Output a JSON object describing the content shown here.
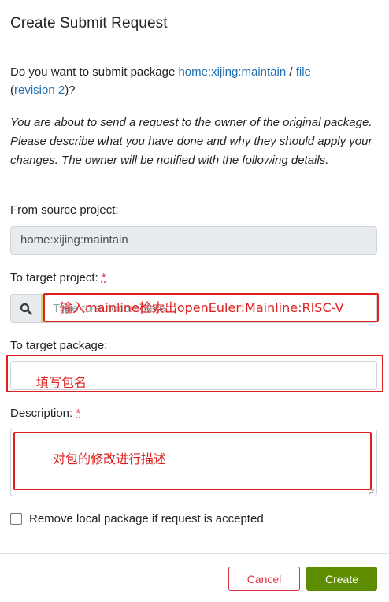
{
  "dialog": {
    "title": "Create Submit Request"
  },
  "intro": {
    "prefix": "Do you want to submit package ",
    "project_link": "home:xijing:maintain",
    "separator": " / ",
    "package_link": "file",
    "open_paren": "(",
    "revision_link": "revision 2",
    "suffix": ")?"
  },
  "note": "You are about to send a request to the owner of the original package. Please describe what you have done and why they should apply your changes. The owner will be notified with the following details.",
  "source_project": {
    "label": "From source project:",
    "value": "home:xijing:maintain"
  },
  "target_project": {
    "label": "To target project:",
    "required_mark": "*",
    "placeholder": "Type to autocomplete..."
  },
  "target_package": {
    "label": "To target package:",
    "value": ""
  },
  "description": {
    "label": "Description:",
    "required_mark": "*",
    "value": ""
  },
  "remove_local": {
    "label": "Remove local package if request is accepted",
    "checked": false
  },
  "footer": {
    "cancel_label": "Cancel",
    "create_label": "Create"
  },
  "annotations": {
    "target_project_hint": "输入mainline检索出openEuler:Mainline:RISC-V",
    "target_package_hint": "填写包名",
    "description_hint": "对包的修改进行描述",
    "color": "#e02020"
  },
  "colors": {
    "link": "#1f6fb2",
    "create_button": "#5e8e00",
    "cancel_border": "#dc3545"
  }
}
